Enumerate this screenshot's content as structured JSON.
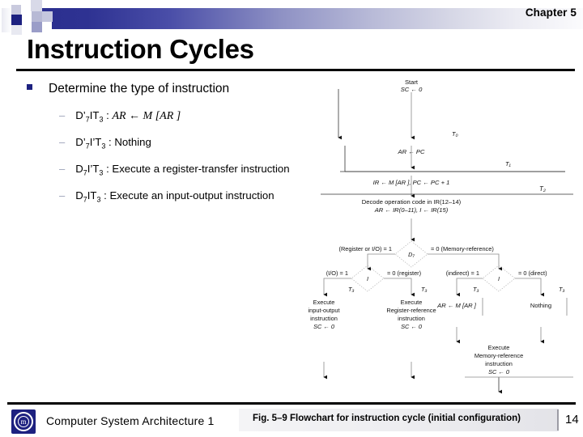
{
  "header": {
    "chapter": "Chapter 5",
    "title": "Instruction Cycles"
  },
  "content": {
    "bullet": "Determine the type of instruction",
    "items": [
      {
        "dash": "–",
        "cond_a": "D’",
        "cond_a_sub": "7",
        "cond_b": "IT",
        "cond_b_sub": "3",
        "colon": " : ",
        "action": "AR ← M [AR ]"
      },
      {
        "dash": "–",
        "cond_a": "D’",
        "cond_a_sub": "7",
        "cond_b": "I’T",
        "cond_b_sub": "3",
        "colon": " : ",
        "action": "Nothing"
      },
      {
        "dash": "–",
        "cond_a": "D",
        "cond_a_sub": "7",
        "cond_b": "I’T",
        "cond_b_sub": "3",
        "colon": " : ",
        "action": "Execute a register-transfer instruction"
      },
      {
        "dash": "–",
        "cond_a": "D",
        "cond_a_sub": "7",
        "cond_b": "IT",
        "cond_b_sub": "3",
        "colon": " : ",
        "action": "Execute an input-output instruction"
      }
    ]
  },
  "flowchart": {
    "start_line1": "Start",
    "start_line2": "SC ← 0",
    "t0_label": "T₀",
    "t0_action": "AR ← PC",
    "t1_label": "T₁",
    "t1_action": "IR ← M [AR ], PC ← PC + 1",
    "t2_label": "T₂",
    "t2_action_line1": "Decode operation code in IR(12–14)",
    "t2_action_line2": "AR ← IR(0–11), I ← IR(15)",
    "d7_node": "D₇",
    "d7_left": "(Register or I/O) = 1",
    "d7_right": "= 0 (Memory-reference)",
    "i_node_left": "I",
    "i_left_left": "(I/O) = 1",
    "i_left_right": "= 0 (register)",
    "i_node_right": "I",
    "i_right_left": "(indirect) = 1",
    "i_right_right": "= 0 (direct)",
    "t3_a_label": "T₃",
    "t3_b_label": "T₃",
    "t3_c_label": "T₃",
    "t3_d_label": "T₃",
    "box_io": [
      "Execute",
      "input-output",
      "instruction",
      "SC ← 0"
    ],
    "box_reg": [
      "Execute",
      "Register-reference",
      "instruction",
      "SC ← 0"
    ],
    "box_indirect": "AR ← M [AR ]",
    "box_nothing": "Nothing",
    "box_mem": [
      "Execute",
      "Memory-reference",
      "instruction",
      "SC ← 0"
    ]
  },
  "footer": {
    "course": "Computer System Architecture 1",
    "caption": "Fig. 5–9  Flowchart for instruction cycle (initial configuration)",
    "page": "14",
    "logo_letter": "m"
  },
  "colors": {
    "accent_navy": "#1d2180",
    "rule_black": "#000000",
    "dash_gray": "#9aa0b8"
  }
}
